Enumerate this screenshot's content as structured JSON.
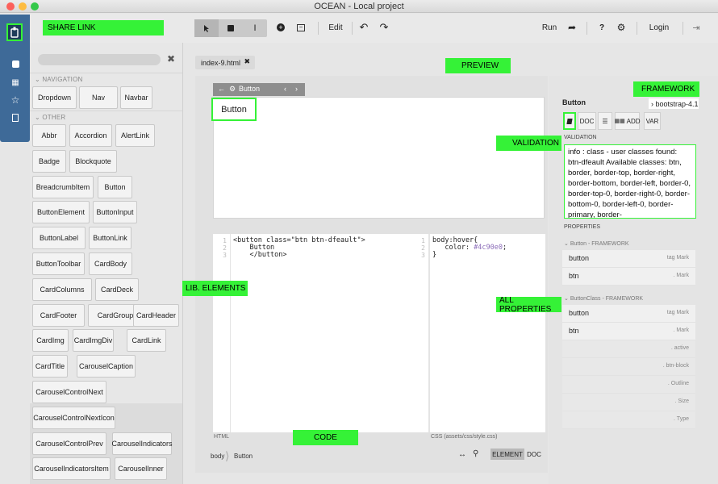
{
  "window": {
    "title": "OCEAN - Local project"
  },
  "toolbar": {
    "edit": "Edit",
    "run": "Run",
    "help": "?",
    "login": "Login"
  },
  "annotations": {
    "share_link": "SHARE LINK",
    "preview": "PREVIEW",
    "framework": "FRAMEWORK",
    "validation": "VALIDATION",
    "lib_elements": "LIB. ELEMENTS",
    "all_properties": "ALL PROPERTIES",
    "code": "CODE"
  },
  "library": {
    "nav_section": "NAVIGATION",
    "other_section": "OTHER",
    "nav_items": [
      "Dropdown",
      "Nav",
      "Navbar"
    ],
    "other_items": [
      "Abbr",
      "Accordion",
      "AlertLink",
      "Badge",
      "Blockquote",
      "BreadcrumbItem",
      "Button",
      "ButtonElement",
      "ButtonInput",
      "ButtonLabel",
      "ButtonLink",
      "ButtonToolbar",
      "CardBody",
      "CardColumns",
      "CardDeck",
      "CardFooter",
      "CardGroup",
      "CardHeader",
      "CardImg",
      "CardImgDiv",
      "CardLink",
      "CardTitle",
      "CarouselCaption",
      "CarouselControlNext",
      "CarouselControlNextIcon",
      "CarouselControlPrev",
      "CarouselIndicators",
      "CarouselIndicatorsItem",
      "CarouselInner"
    ]
  },
  "editor": {
    "tab": "index-9.html",
    "selection_label": "Button",
    "preview_button": "Button",
    "html_code": "<button class=\"btn btn-dfeault\">\n    Button\n    </button>",
    "css_code": "body:hover{\n   color: #4c90e0;\n}",
    "html_label": "HTML",
    "css_label": "CSS (assets/css/style.css)",
    "breadcrumb": [
      "body",
      "Button"
    ],
    "footer_element": "ELEMENT",
    "footer_doc": "DOC"
  },
  "inspector": {
    "element": "Button",
    "framework": "bootstrap-4.1",
    "tabs": {
      "doc": "DOC",
      "add": "ADD",
      "var": "VAR"
    },
    "validation_label": "VALIDATION",
    "validation_text": "info : class - user classes found: btn-dfeault\nAvailable classes: btn, border, border-top, border-right, border-bottom, border-left, border-0, border-top-0, border-right-0, border-bottom-0, border-left-0, border-primary, border-",
    "properties_label": "PROPERTIES",
    "group1": "Button - FRAMEWORK",
    "group1_rows": [
      {
        "name": "button",
        "type": "tag Mark"
      },
      {
        "name": "btn",
        "type": ". Mark"
      }
    ],
    "group2": "ButtonClass - FRAMEWORK",
    "group2_rows": [
      {
        "name": "button",
        "type": "tag Mark"
      },
      {
        "name": "btn",
        "type": ". Mark"
      },
      {
        "name": "",
        "type": ". active"
      },
      {
        "name": "",
        "type": ". btn-block"
      },
      {
        "name": "",
        "type": ". Outline"
      },
      {
        "name": "",
        "type": ". Size"
      },
      {
        "name": "",
        "type": ". Type"
      }
    ]
  },
  "colors": {
    "highlight": "#35f237",
    "iconbar": "#3e6a98",
    "css_value": "#4c90e0"
  },
  "icons": [
    "pointer-icon",
    "square-icon",
    "text-cursor-icon",
    "plus-circle-icon",
    "minus-box-icon",
    "undo-icon",
    "redo-icon",
    "share-icon",
    "gear-icon",
    "logout-icon",
    "home-icon",
    "grid-icon",
    "star-icon",
    "page-icon"
  ]
}
